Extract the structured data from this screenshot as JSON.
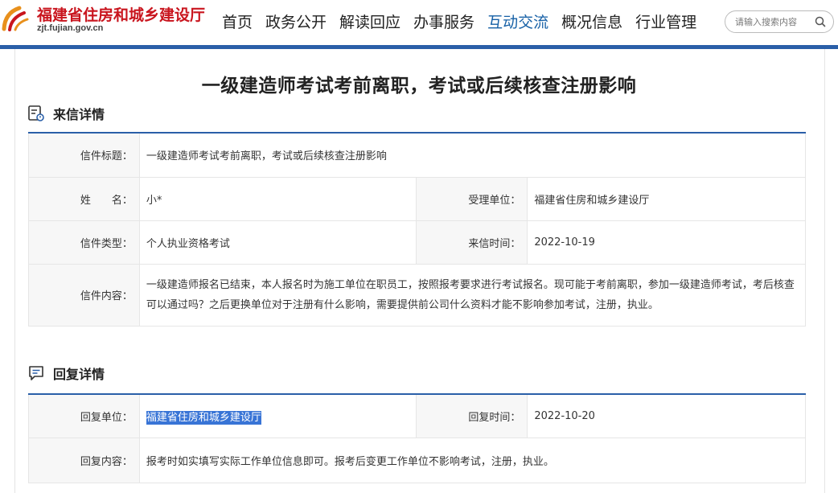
{
  "site": {
    "logo_text": "福建省住房和城乡建设厅",
    "logo_url": "zjt.fujian.gov.cn"
  },
  "nav": {
    "items": [
      {
        "label": "首页",
        "active": false
      },
      {
        "label": "政务公开",
        "active": false
      },
      {
        "label": "解读回应",
        "active": false
      },
      {
        "label": "办事服务",
        "active": false
      },
      {
        "label": "互动交流",
        "active": true
      },
      {
        "label": "概况信息",
        "active": false
      },
      {
        "label": "行业管理",
        "active": false
      }
    ]
  },
  "search": {
    "placeholder": "请输入搜索内容",
    "icon": "search-icon"
  },
  "page": {
    "title": "一级建造师考试考前离职，考试或后续核查注册影响"
  },
  "letter": {
    "section_title": "来信详情",
    "section_icon": "document-icon",
    "subject_label": "信件标题：",
    "subject_value": "一级建造师考试考前离职，考试或后续核查注册影响",
    "name_label": "姓　　名：",
    "name_value": "小*",
    "dept_label": "受理单位：",
    "dept_value": "福建省住房和城乡建设厅",
    "type_label": "信件类型：",
    "type_value": "个人执业资格考试",
    "time_label": "来信时间：",
    "time_value": "2022-10-19",
    "content_label": "信件内容：",
    "content_value": "一级建造师报名已结束，本人报名时为施工单位在职员工，按照报考要求进行考试报名。现可能于考前离职，参加一级建造师考试，考后核查可以通过吗？之后更换单位对于注册有什么影响，需要提供前公司什么资料才能不影响参加考试，注册，执业。"
  },
  "reply": {
    "section_title": "回复详情",
    "section_icon": "chat-icon",
    "unit_label": "回复单位：",
    "unit_value": "福建省住房和城乡建设厅",
    "time_label": "回复时间：",
    "time_value": "2022-10-20",
    "content_label": "回复内容：",
    "content_value": "报考时如实填写实际工作单位信息即可。报考后变更工作单位不影响考试，注册，执业。"
  },
  "colors": {
    "brand_blue": "#2a5fa8",
    "nav_active": "#1660a6",
    "logo_red": "#c9151e",
    "highlight": "#3874d6"
  }
}
